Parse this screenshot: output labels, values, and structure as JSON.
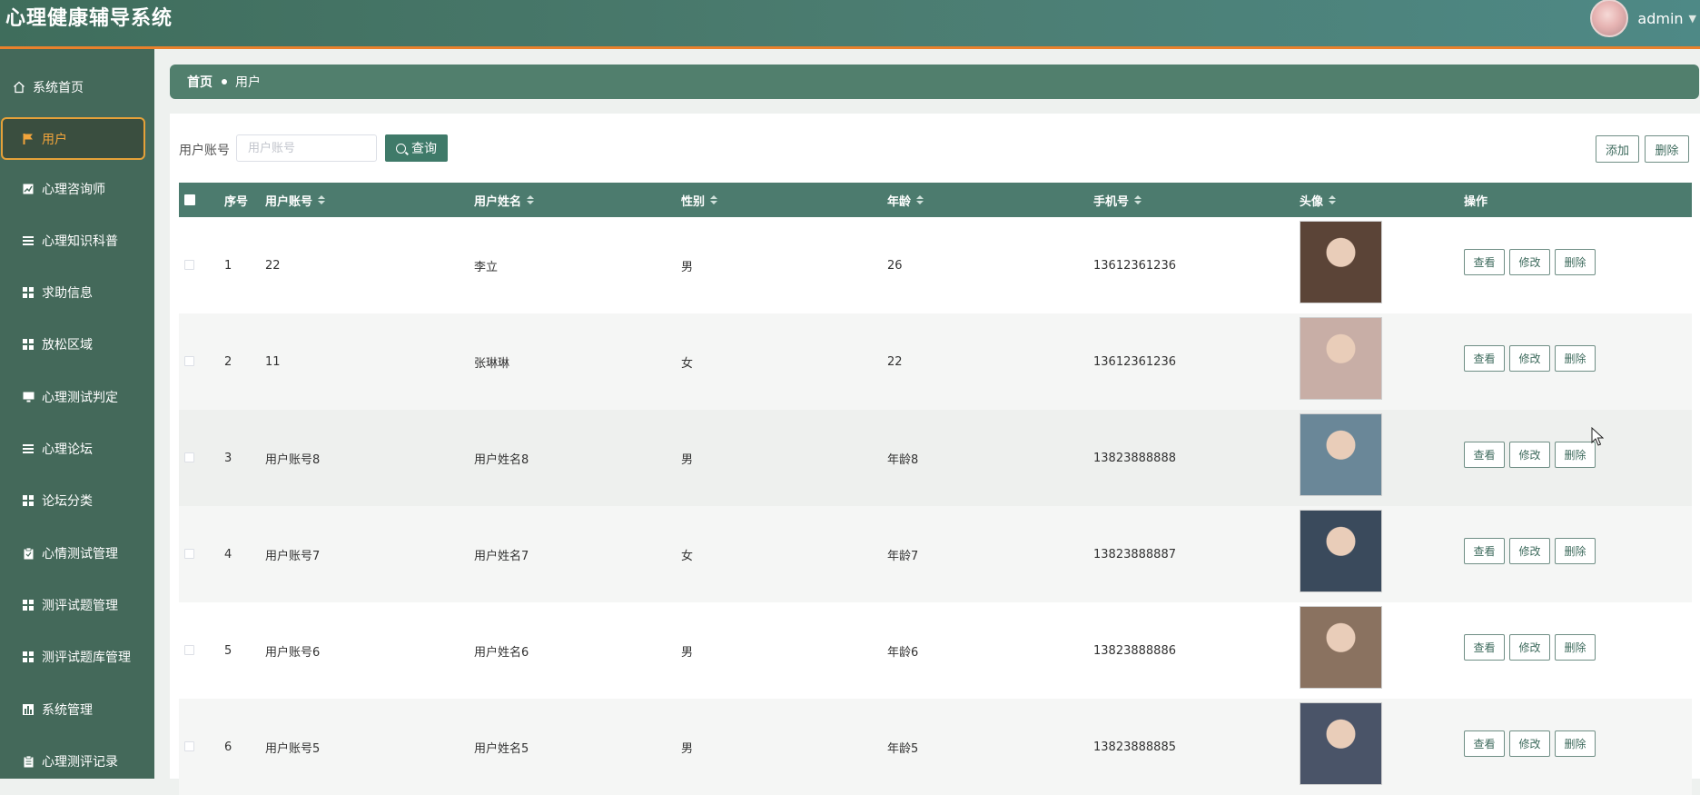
{
  "app": {
    "title": "心理健康辅导系统"
  },
  "user": {
    "name": "admin"
  },
  "colors": {
    "sidebar": "#44695a",
    "header": "#4b7c70",
    "accent": "#e9812c",
    "active_text": "#f1a43b",
    "primary_button": "#3f7a69"
  },
  "sidebar": {
    "items": [
      {
        "label": "系统首页",
        "icon": "home-icon"
      },
      {
        "label": "用户",
        "icon": "flag-icon",
        "active": true
      },
      {
        "label": "心理咨询师",
        "icon": "chart-icon"
      },
      {
        "label": "心理知识科普",
        "icon": "list-icon"
      },
      {
        "label": "求助信息",
        "icon": "grid-icon"
      },
      {
        "label": "放松区域",
        "icon": "grid-icon"
      },
      {
        "label": "心理测试判定",
        "icon": "monitor-icon"
      },
      {
        "label": "心理论坛",
        "icon": "list-icon"
      },
      {
        "label": "论坛分类",
        "icon": "grid-icon"
      },
      {
        "label": "心情测试管理",
        "icon": "clipboard-icon"
      },
      {
        "label": "测评试题管理",
        "icon": "grid-icon"
      },
      {
        "label": "测评试题库管理",
        "icon": "grid-icon"
      },
      {
        "label": "系统管理",
        "icon": "bar-chart-icon"
      },
      {
        "label": "心理测评记录",
        "icon": "clipboard-icon"
      }
    ]
  },
  "breadcrumb": {
    "home": "首页",
    "current": "用户"
  },
  "search": {
    "label": "用户账号",
    "placeholder": "用户账号",
    "value": "",
    "button": "查询"
  },
  "toolbar": {
    "add": "添加",
    "delete": "删除"
  },
  "table": {
    "columns": {
      "index": "序号",
      "account": "用户账号",
      "name": "用户姓名",
      "gender": "性别",
      "age": "年龄",
      "phone": "手机号",
      "avatar": "头像",
      "actions": "操作"
    },
    "action_labels": {
      "view": "查看",
      "edit": "修改",
      "delete": "删除"
    },
    "rows": [
      {
        "index": "1",
        "account": "22",
        "name": "李立",
        "gender": "男",
        "age": "26",
        "phone": "13612361236",
        "photo": "#5b4437"
      },
      {
        "index": "2",
        "account": "11",
        "name": "张琳琳",
        "gender": "女",
        "age": "22",
        "phone": "13612361236",
        "photo": "#c8aea6"
      },
      {
        "index": "3",
        "account": "用户账号8",
        "name": "用户姓名8",
        "gender": "男",
        "age": "年龄8",
        "phone": "13823888888",
        "photo": "#6a8798"
      },
      {
        "index": "4",
        "account": "用户账号7",
        "name": "用户姓名7",
        "gender": "女",
        "age": "年龄7",
        "phone": "13823888887",
        "photo": "#3a4a5c"
      },
      {
        "index": "5",
        "account": "用户账号6",
        "name": "用户姓名6",
        "gender": "男",
        "age": "年龄6",
        "phone": "13823888886",
        "photo": "#8a7260"
      },
      {
        "index": "6",
        "account": "用户账号5",
        "name": "用户姓名5",
        "gender": "男",
        "age": "年龄5",
        "phone": "13823888885",
        "photo": "#4a5468"
      }
    ]
  }
}
